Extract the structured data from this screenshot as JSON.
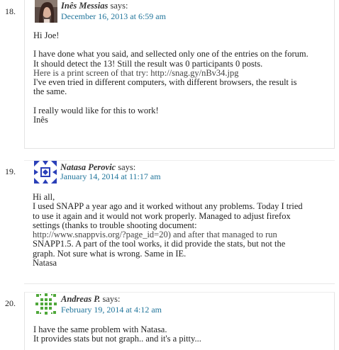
{
  "comments": [
    {
      "number": "18.",
      "author": "Inês Messias",
      "says": "says:",
      "date": "December 16, 2013 at 6:59 am",
      "paragraphs": [
        [
          "Hi Joe!"
        ],
        [
          "I have done what you said, and sellected only one of the entries on the forum.",
          "It should detect the 13! Still the result was 0 participants 0 posts.",
          "Here is a print screen of that try: http://snag.gy/nBv34.jpg",
          "I've even tried in different computers, with different browsers, the result is",
          "the same."
        ],
        [
          "I really would like for this to work!",
          "Inês"
        ]
      ]
    },
    {
      "number": "19.",
      "author": "Natasa Perovic",
      "says": "says:",
      "date": "January 14, 2014 at 11:17 am",
      "paragraphs": [
        [
          "Hi all,",
          "I used SNAPP a year ago and it worked without any problems. Today I tried",
          "to use it again and it would not work properly. Managed to adjust firefox",
          "settings (thanks to trouble shooting document:",
          "http://www.snappvis.org/?page_id=20) and after that managed to run",
          "SNAPP1.5. A part of the tool works, it did provide the stats, but not the",
          "graph. Not sure what is wrong. Same in IE.",
          "Natasa"
        ]
      ]
    },
    {
      "number": "20.",
      "author": "Andreas P.",
      "says": "says:",
      "date": "February 19, 2014 at 4:12 am",
      "paragraphs": [
        [
          "I have the same problem with Natasa.",
          "It provides stats but not graph.. and it's a pitty..."
        ]
      ]
    }
  ]
}
